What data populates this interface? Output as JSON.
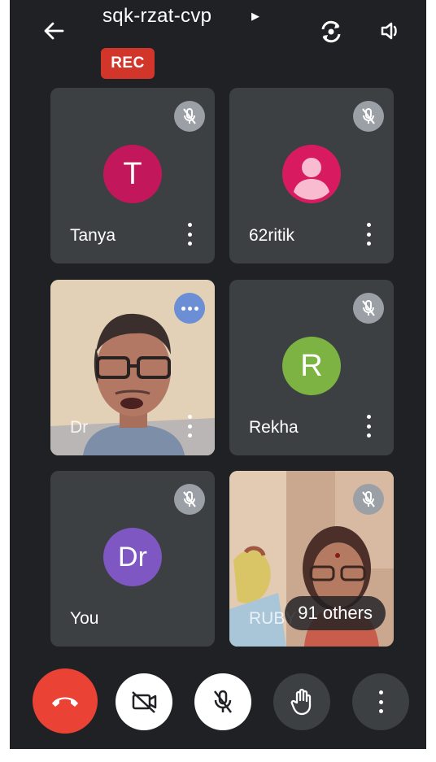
{
  "meeting": {
    "code": "sqk-rzat-cvp",
    "recording_label": "REC"
  },
  "icons": {
    "back": "arrow-left-icon",
    "caret": "caret-right-icon",
    "switch_camera": "switch-camera-icon",
    "speaker": "speaker-icon",
    "muted": "mic-off-icon",
    "more": "more-vert-icon"
  },
  "participants": [
    {
      "name": "Tanya",
      "avatar_letter": "T",
      "avatar_color": "#c2185b",
      "muted": true
    },
    {
      "name": "62ritik",
      "avatar_type": "default-person",
      "avatar_color": "#d81b60",
      "muted": true
    },
    {
      "name": "Dr",
      "video": true,
      "speaking": true
    },
    {
      "name": "Rekha",
      "avatar_letter": "R",
      "avatar_color": "#7cb342",
      "muted": true
    },
    {
      "name": "You",
      "avatar_letter": "Dr",
      "avatar_color": "#7e57c2",
      "muted": true
    },
    {
      "name": "RUBY",
      "video": true,
      "muted": true
    }
  ],
  "others_label": "91 others",
  "controls": {
    "end_call": "call-end-icon",
    "camera": "videocam-off-icon",
    "mic": "mic-off-icon",
    "raise_hand": "hand-icon",
    "more": "more-vert-icon"
  },
  "colors": {
    "background": "#202124",
    "tile": "#3c4043",
    "rec": "#d2362b",
    "end_call": "#ea4335",
    "speaking": "#6c8ed4"
  }
}
